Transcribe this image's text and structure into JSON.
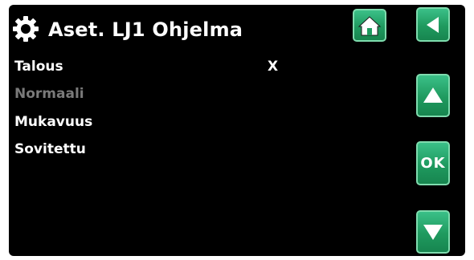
{
  "header": {
    "title": "Aset. LJ1 Ohjelma",
    "settings_icon": "gear-icon",
    "home_icon": "home-icon",
    "back_icon": "back-arrow-icon"
  },
  "menu": {
    "items": [
      {
        "label": "Talous",
        "state": "selected"
      },
      {
        "label": "Normaali",
        "state": "disabled"
      },
      {
        "label": "Mukavuus",
        "state": "normal"
      },
      {
        "label": "Sovitettu",
        "state": "normal"
      }
    ],
    "selected_marker": "X"
  },
  "side_buttons": {
    "up_icon": "up-arrow-icon",
    "ok_label": "OK",
    "down_icon": "down-arrow-icon"
  },
  "colors": {
    "background": "#000000",
    "button_green": "#1f9a5f",
    "text": "#ffffff",
    "disabled_text": "#7a7a7a"
  }
}
